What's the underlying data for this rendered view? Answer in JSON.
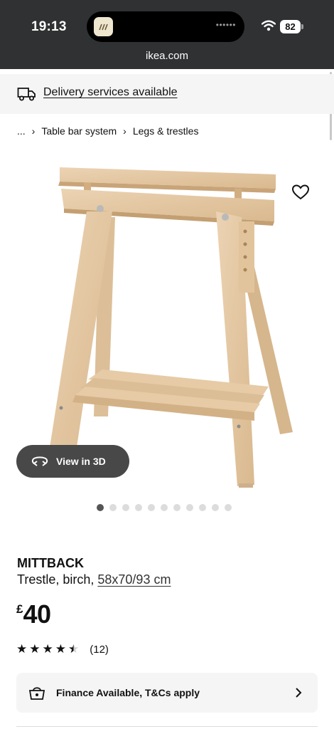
{
  "status_bar": {
    "time": "19:13",
    "battery": "82",
    "island_dots": "••••••"
  },
  "browser": {
    "url": "ikea.com"
  },
  "delivery": {
    "icon": "truck-icon",
    "label": "Delivery services available"
  },
  "breadcrumb": {
    "ellipsis": "...",
    "items": [
      "Table bar system",
      "Legs & trestles"
    ]
  },
  "gallery": {
    "view3d_label": "View in 3D",
    "image_count": 11,
    "active_index": 0
  },
  "product": {
    "name": "MITTBACK",
    "description": "Trestle, birch,",
    "size": "58x70/93 cm",
    "currency": "£",
    "price": "40",
    "rating": 4.5,
    "rating_max": 5,
    "review_count": "(12)"
  },
  "finance": {
    "label": "Finance Available, T&Cs apply"
  },
  "colors": {
    "chrome_bg": "#2f3133",
    "banner_bg": "#f5f5f5",
    "wood": "#e4c9a6",
    "button_dark": "#484848"
  }
}
